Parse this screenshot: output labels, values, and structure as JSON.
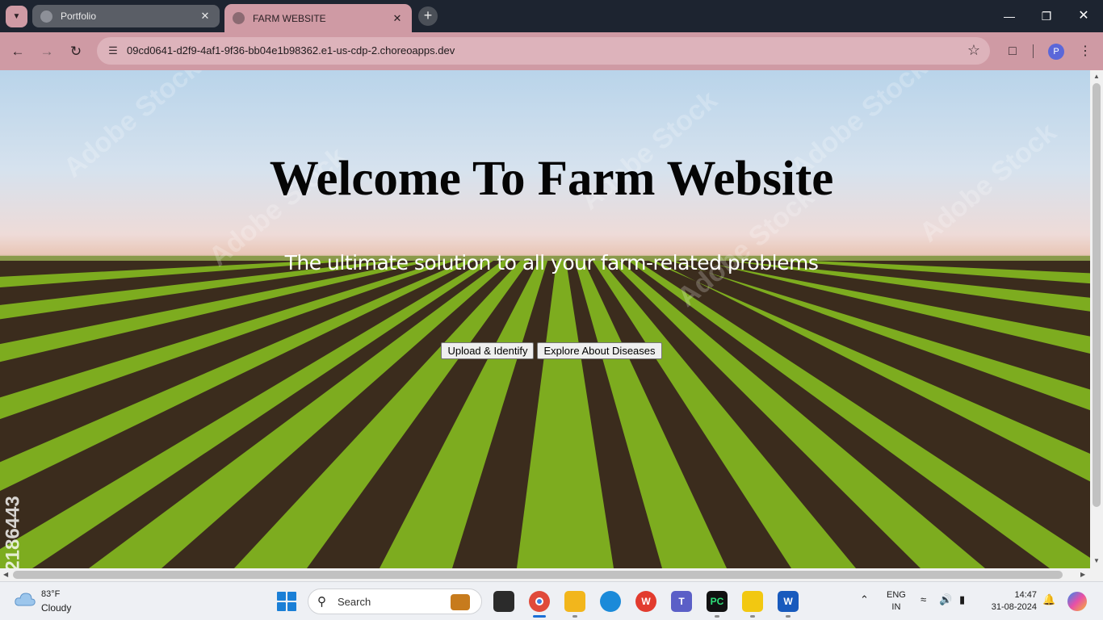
{
  "browser": {
    "tabs": [
      {
        "title": "Portfolio",
        "active": false
      },
      {
        "title": "FARM WEBSITE",
        "active": true
      }
    ],
    "url": "09cd0641-d2f9-4af1-9f36-bb04e1b98362.e1-us-cdp-2.choreoapps.dev",
    "profile_initial": "P"
  },
  "page": {
    "title": "Welcome To Farm Website",
    "subtitle": "The ultimate solution to all your farm-related problems",
    "buttons": {
      "upload": "Upload & Identify",
      "explore": "Explore About Diseases"
    },
    "stock_id": "2186443",
    "watermark": "Adobe Stock"
  },
  "taskbar": {
    "weather_temp": "83°F",
    "weather_condition": "Cloudy",
    "search_label": "Search",
    "lang_primary": "ENG",
    "lang_secondary": "IN",
    "time": "14:47",
    "date": "31-08-2024"
  },
  "colors": {
    "browser_accent": "#cf9aa4",
    "tab_strip": "#1d2430",
    "title_text": "#050505",
    "subtitle_text": "#ffffff"
  }
}
